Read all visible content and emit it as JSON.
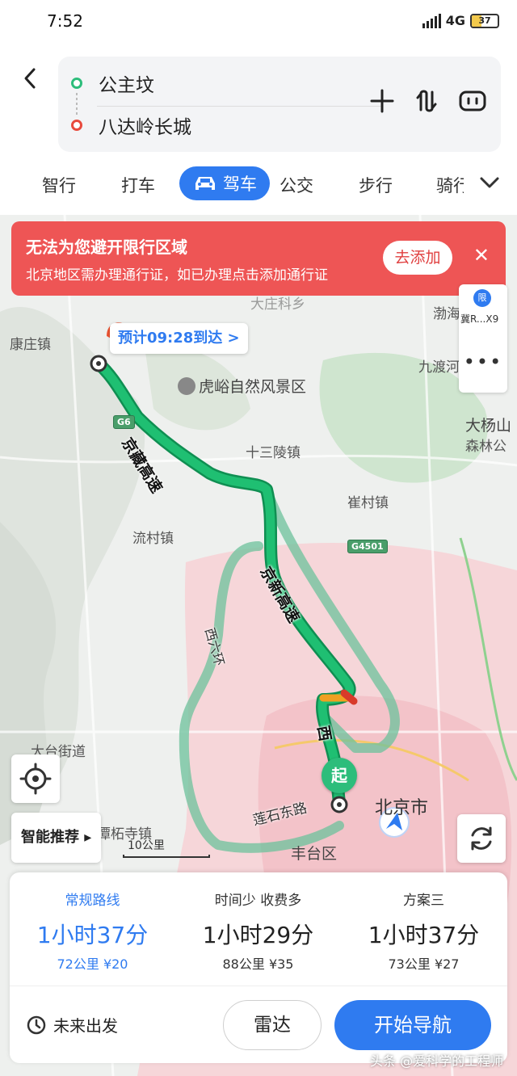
{
  "status_bar": {
    "time": "7:52",
    "network": "4G",
    "battery": "37",
    "battery_level": 0.37
  },
  "route": {
    "start": "公主坟",
    "end": "八达岭长城"
  },
  "tabs": [
    {
      "label": "智行"
    },
    {
      "label": "打车"
    },
    {
      "label": "驾车",
      "active": true
    },
    {
      "label": "公交"
    },
    {
      "label": "步行"
    },
    {
      "label": "骑行"
    }
  ],
  "alert": {
    "title": "无法为您避开限行区域",
    "message": "北京地区需办理通行证，如已办理点击添加通行证",
    "button": "去添加"
  },
  "map": {
    "eta": "预计09:28到达 >",
    "side_panel": {
      "limit_badge": "限",
      "plate": "冀R...X9"
    },
    "labels": {
      "kangzhuang": "康庄镇",
      "huyu": "虎峪自然风景区",
      "shisanling": "十三陵镇",
      "cuicun": "崔村镇",
      "liucun": "流村镇",
      "taitai": "大台街道",
      "tanzhe": "潭柘寺镇",
      "beijing": "北京市",
      "fengtai": "丰台区",
      "daxingshan": "大杨山",
      "forest": "森林公",
      "jiudu": "九渡河",
      "bohai": "渤海",
      "dazhuang": "大庄科乡"
    },
    "road_badges": {
      "g6": "G6",
      "g4501": "G4501"
    },
    "road_names": {
      "jingzang": "京藏高速",
      "jingxin": "京新高速",
      "xiliuhuan": "西六环",
      "lianshi": "莲石东路",
      "xi": "西"
    },
    "start_pin": "起",
    "smart_button": "智能推荐 ▸",
    "scale": "10公里"
  },
  "plans": [
    {
      "name": "常规路线",
      "duration": "1小时37分",
      "info": "72公里 ¥20",
      "selected": true
    },
    {
      "name": "时间少 收费多",
      "duration": "1小时29分",
      "info": "88公里 ¥35",
      "selected": false
    },
    {
      "name": "方案三",
      "duration": "1小时37分",
      "info": "73公里 ¥27",
      "selected": false
    }
  ],
  "footer": {
    "future": "未来出发",
    "radar": "雷达",
    "navigate": "开始导航"
  },
  "watermark": "头条 @爱科学的工程师",
  "colors": {
    "accent": "#2f7bf0",
    "alert": "#ee5555",
    "route": "#19b36b",
    "start": "#2dbd7b",
    "end": "#e84a3d"
  }
}
